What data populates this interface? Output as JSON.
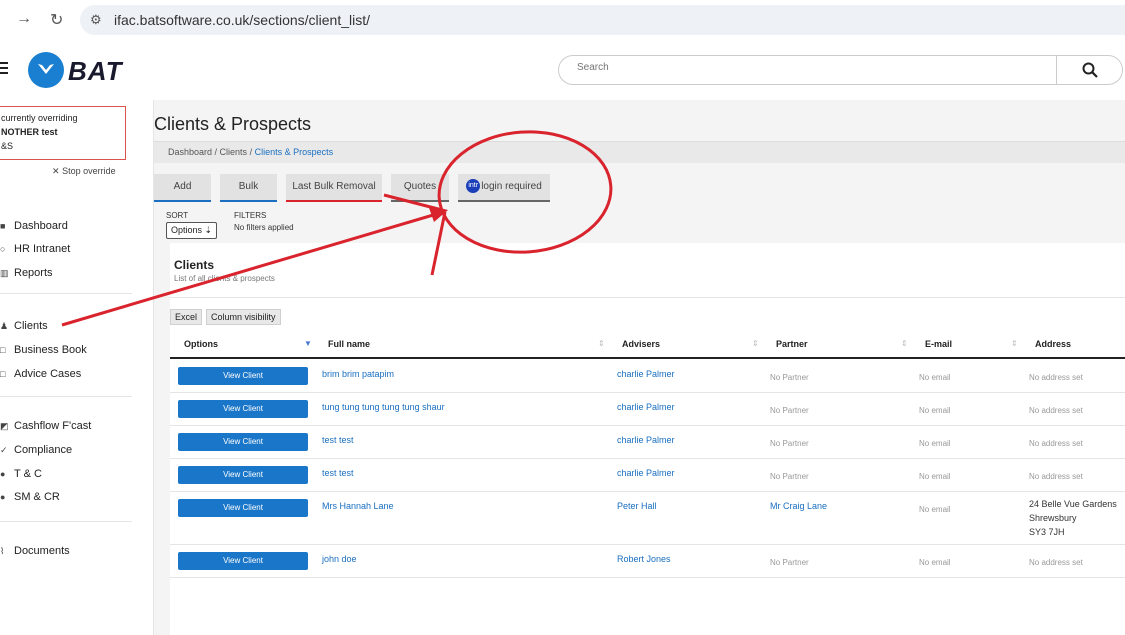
{
  "browser": {
    "url": "ifac.batsoftware.co.uk/sections/client_list/"
  },
  "header": {
    "logo_text": "BAT",
    "search_placeholder": "Search"
  },
  "override": {
    "line1": "currently overriding",
    "line2": "NOTHER test",
    "line3": "&S",
    "stop_label": "Stop override"
  },
  "sidebar": {
    "items": [
      {
        "label": "Dashboard",
        "icon": "grid-icon"
      },
      {
        "label": "HR Intranet",
        "icon": "user-icon"
      },
      {
        "label": "Reports",
        "icon": "bar-chart-icon"
      },
      {
        "label": "Clients",
        "icon": "users-icon"
      },
      {
        "label": "Business Book",
        "icon": "book-icon"
      },
      {
        "label": "Advice Cases",
        "icon": "case-icon"
      },
      {
        "label": "Cashflow F'cast",
        "icon": "cashflow-icon"
      },
      {
        "label": "Compliance",
        "icon": "check-icon"
      },
      {
        "label": "T & C",
        "icon": "dot-icon"
      },
      {
        "label": "SM & CR",
        "icon": "dot-icon"
      },
      {
        "label": "Documents",
        "icon": "clip-icon"
      }
    ]
  },
  "main": {
    "title": "Clients & Prospects",
    "breadcrumb": [
      "Dashboard",
      "Clients",
      "Clients & Prospects"
    ],
    "tabs": [
      {
        "label": "Add"
      },
      {
        "label": "Bulk"
      },
      {
        "label": "Last Bulk Removal"
      },
      {
        "label": "Quotes"
      },
      {
        "label": "login required",
        "badge": "intr"
      }
    ],
    "sort_label": "SORT",
    "sort_button": "Options",
    "filters_label": "FILTERS",
    "filters_value": "No filters applied"
  },
  "card": {
    "title": "Clients",
    "subtitle": "List of all clients & prospects",
    "excel_label": "Excel",
    "column_visibility_label": "Column visibility",
    "columns": [
      "Options",
      "Full name",
      "Advisers",
      "Partner",
      "E-mail",
      "Address"
    ],
    "view_label": "View Client",
    "rows": [
      {
        "name": "brim brim patapim",
        "adviser": "charlie Palmer",
        "partner": "No Partner",
        "email": "No email",
        "address": [
          "No address set"
        ],
        "partner_link": false,
        "address_set": false
      },
      {
        "name": "tung tung tung tung tung shaur",
        "adviser": "charlie Palmer",
        "partner": "No Partner",
        "email": "No email",
        "address": [
          "No address set"
        ],
        "partner_link": false,
        "address_set": false
      },
      {
        "name": "test test",
        "adviser": "charlie Palmer",
        "partner": "No Partner",
        "email": "No email",
        "address": [
          "No address set"
        ],
        "partner_link": false,
        "address_set": false
      },
      {
        "name": "test test",
        "adviser": "charlie Palmer",
        "partner": "No Partner",
        "email": "No email",
        "address": [
          "No address set"
        ],
        "partner_link": false,
        "address_set": false
      },
      {
        "name": "Mrs Hannah Lane",
        "adviser": "Peter Hall",
        "partner": "Mr Craig Lane",
        "email": "No email",
        "address": [
          "24 Belle Vue Gardens",
          "Shrewsbury",
          "SY3 7JH"
        ],
        "partner_link": true,
        "address_set": true
      },
      {
        "name": "john doe",
        "adviser": "Robert Jones",
        "partner": "No Partner",
        "email": "No email",
        "address": [
          "No address set"
        ],
        "partner_link": false,
        "address_set": false
      }
    ]
  },
  "colors": {
    "accent": "#1a76c8",
    "annotation_red": "#d9232d"
  }
}
